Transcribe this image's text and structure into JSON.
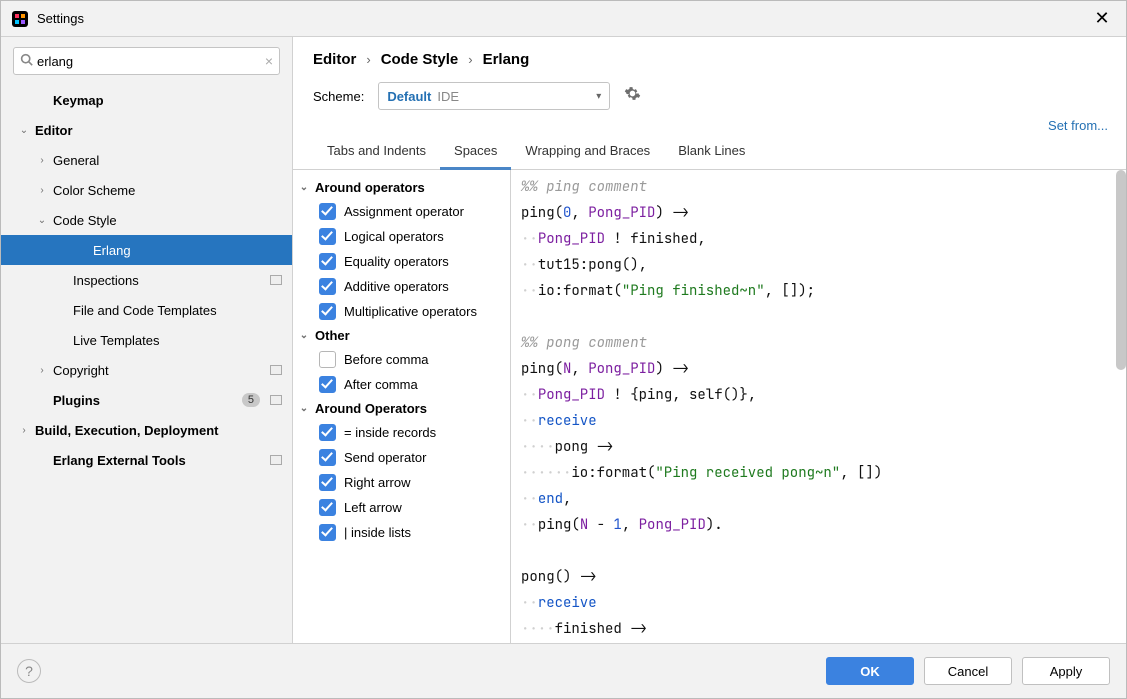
{
  "window": {
    "title": "Settings"
  },
  "search": {
    "value": "erlang"
  },
  "sidebar": {
    "items": [
      {
        "label": "Keymap",
        "kind": "bold",
        "indent": 1
      },
      {
        "label": "Editor",
        "kind": "bold expanded",
        "indent": 0,
        "chev": "down"
      },
      {
        "label": "General",
        "indent": 1,
        "chev": "right"
      },
      {
        "label": "Color Scheme",
        "indent": 1,
        "chev": "right"
      },
      {
        "label": "Code Style",
        "indent": 1,
        "chev": "down"
      },
      {
        "label": "Erlang",
        "indent": 3,
        "selected": true
      },
      {
        "label": "Inspections",
        "indent": 2,
        "mod": true
      },
      {
        "label": "File and Code Templates",
        "indent": 2
      },
      {
        "label": "Live Templates",
        "indent": 2
      },
      {
        "label": "Copyright",
        "indent": 1,
        "chev": "right",
        "mod": true
      },
      {
        "label": "Plugins",
        "kind": "bold",
        "indent": 1,
        "badge": "5",
        "mod": true
      },
      {
        "label": "Build, Execution, Deployment",
        "kind": "bold",
        "indent": 0,
        "chev": "right"
      },
      {
        "label": "Erlang External Tools",
        "kind": "bold",
        "indent": 1,
        "mod": true
      }
    ]
  },
  "breadcrumb": {
    "a": "Editor",
    "b": "Code Style",
    "c": "Erlang"
  },
  "scheme": {
    "label": "Scheme:",
    "value": "Default",
    "scope": "IDE"
  },
  "setfrom": "Set from...",
  "tabs": {
    "items": [
      {
        "label": "Tabs and Indents"
      },
      {
        "label": "Spaces",
        "active": true
      },
      {
        "label": "Wrapping and Braces"
      },
      {
        "label": "Blank Lines"
      }
    ]
  },
  "options": {
    "groups": [
      {
        "title": "Around operators",
        "items": [
          {
            "label": "Assignment operator",
            "checked": true
          },
          {
            "label": "Logical operators",
            "checked": true
          },
          {
            "label": "Equality operators",
            "checked": true
          },
          {
            "label": "Additive operators",
            "checked": true
          },
          {
            "label": "Multiplicative operators",
            "checked": true
          }
        ]
      },
      {
        "title": "Other",
        "items": [
          {
            "label": "Before comma",
            "checked": false
          },
          {
            "label": "After comma",
            "checked": true
          }
        ]
      },
      {
        "title": "Around Operators",
        "items": [
          {
            "label": "= inside records",
            "checked": true
          },
          {
            "label": "Send operator",
            "checked": true
          },
          {
            "label": "Right arrow",
            "checked": true
          },
          {
            "label": "Left arrow",
            "checked": true
          },
          {
            "label": "| inside lists",
            "checked": true
          }
        ]
      }
    ]
  },
  "footer": {
    "ok": "OK",
    "cancel": "Cancel",
    "apply": "Apply"
  }
}
